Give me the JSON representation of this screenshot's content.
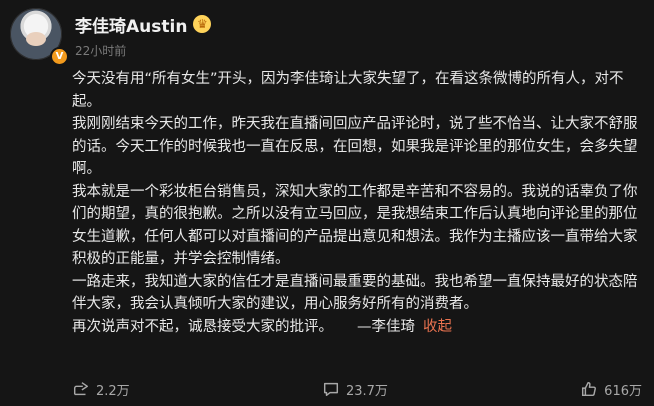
{
  "user": {
    "name": "李佳琦Austin",
    "time": "22小时前"
  },
  "post": {
    "paragraphs": [
      "今天没有用“所有女生”开头，因为李佳琦让大家失望了，在看这条微博的所有人，对不起。",
      "我刚刚结束今天的工作，昨天我在直播间回应产品评论时，说了些不恰当、让大家不舒服的话。今天工作的时候我也一直在反思，在回想，如果我是评论里的那位女生，会多失望啊。",
      "我本就是一个彩妆柜台销售员，深知大家的工作都是辛苦和不容易的。我说的话辜负了你们的期望，真的很抱歉。之所以没有立马回应，是我想结束工作后认真地向评论里的那位女生道歉，任何人都可以对直播间的产品提出意见和想法。我作为主播应该一直带给大家积极的正能量，并学会控制情绪。",
      "一路走来，我知道大家的信任才是直播间最重要的基础。我也希望一直保持最好的状态陪伴大家，我会认真倾听大家的建议，用心服务好所有的消费者。",
      "再次说声对不起，诚恳接受大家的批评。"
    ],
    "signature": "—李佳琦",
    "collapse_label": "收起"
  },
  "actions": {
    "share_count": "2.2万",
    "comment_count": "23.7万",
    "like_count": "616万"
  },
  "colors": {
    "background": "#151515",
    "text": "#e8e8e8",
    "meta": "#7a7a7a",
    "link": "#eb7350",
    "badge": "#f29a1d"
  },
  "icons": [
    "verified-badge-icon",
    "crown-icon",
    "share-icon",
    "comment-icon",
    "like-icon"
  ]
}
